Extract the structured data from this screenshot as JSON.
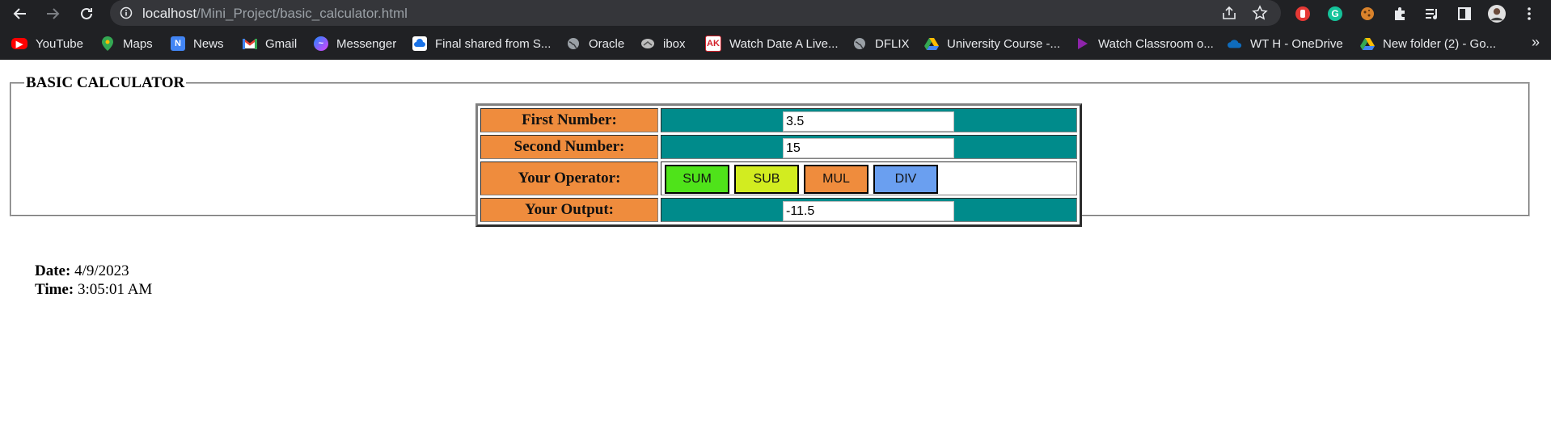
{
  "browser": {
    "url_host": "localhost",
    "url_path": "/Mini_Project/basic_calculator.html",
    "bookmarks": [
      {
        "label": "YouTube",
        "icon": "youtube-icon",
        "color": "#ff0000"
      },
      {
        "label": "Maps",
        "icon": "maps-icon",
        "color": "#34a853"
      },
      {
        "label": "News",
        "icon": "news-icon",
        "color": "#4285f4"
      },
      {
        "label": "Gmail",
        "icon": "gmail-icon",
        "color": "#ea4335"
      },
      {
        "label": "Messenger",
        "icon": "messenger-icon",
        "color": "#a033ff"
      },
      {
        "label": "Final shared from S...",
        "icon": "cloud-upload-icon",
        "color": "#1a73e8"
      },
      {
        "label": "Oracle",
        "icon": "globe-icon",
        "color": "#9aa0a6"
      },
      {
        "label": "ibox",
        "icon": "ibox-icon",
        "color": "#9aa0a6"
      },
      {
        "label": "Watch Date A Live...",
        "icon": "ak-icon",
        "color": "#d3202a"
      },
      {
        "label": "DFLIX",
        "icon": "globe-icon",
        "color": "#9aa0a6"
      },
      {
        "label": "University Course -...",
        "icon": "drive-icon",
        "color": "#fbbc04"
      },
      {
        "label": "Watch Classroom o...",
        "icon": "play-icon",
        "color": "#8e24aa"
      },
      {
        "label": "WT H - OneDrive",
        "icon": "onedrive-icon",
        "color": "#0f6cbd"
      },
      {
        "label": "New folder (2) - Go...",
        "icon": "drive-icon",
        "color": "#fbbc04"
      }
    ],
    "more_label": "»"
  },
  "calculator": {
    "legend": "BASIC CALCULATOR",
    "first_label": "First Number:",
    "first_value": "3.5",
    "second_label": "Second Number:",
    "second_value": "15",
    "operator_label": "Your Operator:",
    "ops": {
      "sum": "SUM",
      "sub": "SUB",
      "mul": "MUL",
      "div": "DIV"
    },
    "output_label": "Your Output:",
    "output_value": "-11.5"
  },
  "datetime": {
    "date_label": "Date:",
    "date_value": "4/9/2023",
    "time_label": "Time:",
    "time_value": "3:05:01 AM"
  }
}
